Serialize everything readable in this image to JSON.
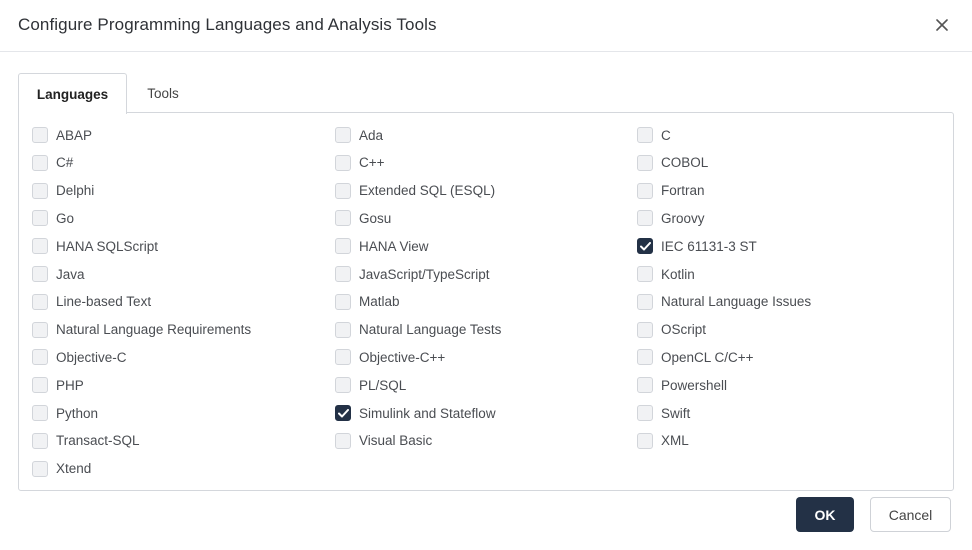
{
  "dialog": {
    "title": "Configure Programming Languages and Analysis Tools",
    "close_icon": "close-icon"
  },
  "tabs": [
    {
      "label": "Languages",
      "active": true
    },
    {
      "label": "Tools",
      "active": false
    }
  ],
  "languages": {
    "columns": [
      [
        {
          "label": "ABAP",
          "checked": false
        },
        {
          "label": "C#",
          "checked": false
        },
        {
          "label": "Delphi",
          "checked": false
        },
        {
          "label": "Go",
          "checked": false
        },
        {
          "label": "HANA SQLScript",
          "checked": false
        },
        {
          "label": "Java",
          "checked": false
        },
        {
          "label": "Line-based Text",
          "checked": false
        },
        {
          "label": "Natural Language Requirements",
          "checked": false
        },
        {
          "label": "Objective-C",
          "checked": false
        },
        {
          "label": "PHP",
          "checked": false
        },
        {
          "label": "Python",
          "checked": false
        },
        {
          "label": "Transact-SQL",
          "checked": false
        },
        {
          "label": "Xtend",
          "checked": false
        }
      ],
      [
        {
          "label": "Ada",
          "checked": false
        },
        {
          "label": "C++",
          "checked": false
        },
        {
          "label": "Extended SQL (ESQL)",
          "checked": false
        },
        {
          "label": "Gosu",
          "checked": false
        },
        {
          "label": "HANA View",
          "checked": false
        },
        {
          "label": "JavaScript/TypeScript",
          "checked": false
        },
        {
          "label": "Matlab",
          "checked": false
        },
        {
          "label": "Natural Language Tests",
          "checked": false
        },
        {
          "label": "Objective-C++",
          "checked": false
        },
        {
          "label": "PL/SQL",
          "checked": false
        },
        {
          "label": "Simulink and Stateflow",
          "checked": true
        },
        {
          "label": "Visual Basic",
          "checked": false
        }
      ],
      [
        {
          "label": "C",
          "checked": false
        },
        {
          "label": "COBOL",
          "checked": false
        },
        {
          "label": "Fortran",
          "checked": false
        },
        {
          "label": "Groovy",
          "checked": false
        },
        {
          "label": "IEC 61131-3 ST",
          "checked": true
        },
        {
          "label": "Kotlin",
          "checked": false
        },
        {
          "label": "Natural Language Issues",
          "checked": false
        },
        {
          "label": "OScript",
          "checked": false
        },
        {
          "label": "OpenCL C/C++",
          "checked": false
        },
        {
          "label": "Powershell",
          "checked": false
        },
        {
          "label": "Swift",
          "checked": false
        },
        {
          "label": "XML",
          "checked": false
        }
      ]
    ]
  },
  "buttons": {
    "ok_label": "OK",
    "cancel_label": "Cancel"
  },
  "colors": {
    "primary": "#233146",
    "checkbox_unchecked": "#f1f2f4",
    "border": "#d4d7dc"
  }
}
